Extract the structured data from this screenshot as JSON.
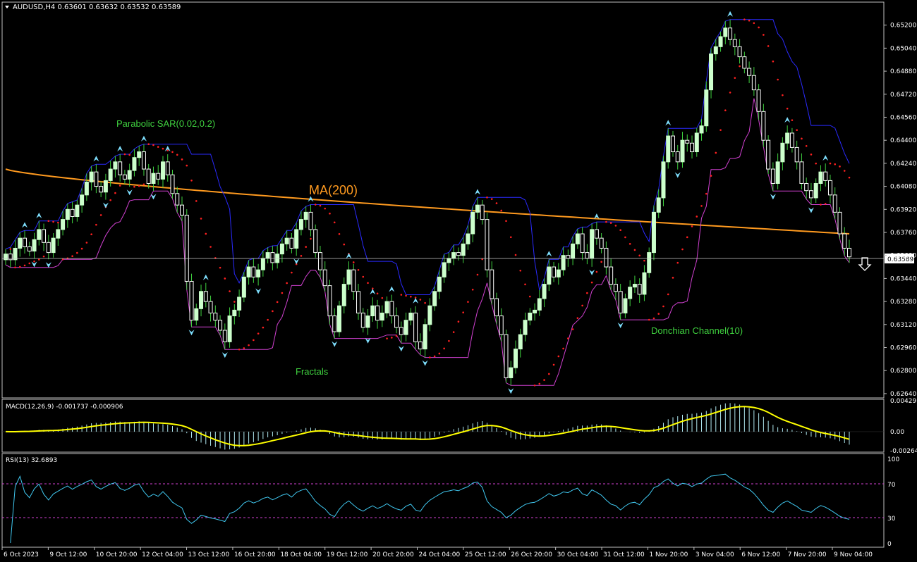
{
  "header": {
    "symbol_info": "AUDUSD,H4  0.63601 0.63632 0.63532 0.63589"
  },
  "annotations": {
    "sar": "Parabolic SAR(0.02,0.2)",
    "ma": "MA(200)",
    "donchian": "Donchian Channel(10)",
    "fractals": "Fractals"
  },
  "price_axis": {
    "ticks": [
      "0.65200",
      "0.65040",
      "0.64880",
      "0.64720",
      "0.64560",
      "0.64400",
      "0.64240",
      "0.64080",
      "0.63920",
      "0.63760",
      "0.63600",
      "0.63440",
      "0.63280",
      "0.63120",
      "0.62960",
      "0.62800",
      "0.62640"
    ],
    "current_price": "0.63589"
  },
  "time_axis": {
    "labels": [
      "6 Oct 2023",
      "9 Oct 12:00",
      "10 Oct 20:00",
      "12 Oct 04:00",
      "13 Oct 12:00",
      "16 Oct 20:00",
      "18 Oct 04:00",
      "19 Oct 12:00",
      "20 Oct 20:00",
      "24 Oct 04:00",
      "25 Oct 12:00",
      "26 Oct 20:00",
      "30 Oct 04:00",
      "31 Oct 12:00",
      "1 Nov 20:00",
      "3 Nov 04:00",
      "6 Nov 12:00",
      "7 Nov 20:00",
      "9 Nov 04:00"
    ]
  },
  "macd": {
    "label": "MACD(12,26,9) -0.001737 -0.000906",
    "ticks": [
      "0.004291",
      "0.00",
      "-0.002641"
    ]
  },
  "rsi": {
    "label": "RSI(13) 32.6893",
    "ticks": [
      "100",
      "70",
      "30",
      "0"
    ]
  },
  "colors": {
    "up_candle": "#ccffcc",
    "down_candle": "#ffffff",
    "wick": "#3fd13f",
    "ma": "#ff9a1f",
    "donchian_upper": "#2a2aff",
    "donchian_lower": "#d040d0",
    "sar": "#ff2020",
    "fractal": "#7fe0ff",
    "macd_signal": "#ffff00",
    "macd_hist": "#b0e8f0",
    "rsi_line": "#40c8f0",
    "rsi_levels": "#d040d0"
  },
  "chart_data": {
    "type": "candlestick",
    "symbol": "AUDUSD",
    "timeframe": "H4",
    "ohlc_last": {
      "open": 0.63601,
      "high": 0.63632,
      "low": 0.63532,
      "close": 0.63589
    },
    "close_approx": [
      0.6361,
      0.6357,
      0.6365,
      0.6372,
      0.6366,
      0.6363,
      0.6371,
      0.6378,
      0.6369,
      0.6362,
      0.6372,
      0.6378,
      0.6385,
      0.6392,
      0.6387,
      0.6395,
      0.6402,
      0.6411,
      0.6418,
      0.6408,
      0.6404,
      0.6412,
      0.642,
      0.6425,
      0.6416,
      0.6413,
      0.6419,
      0.6428,
      0.6432,
      0.642,
      0.641,
      0.6417,
      0.6413,
      0.6425,
      0.6416,
      0.6403,
      0.6395,
      0.6388,
      0.6342,
      0.6315,
      0.6323,
      0.6335,
      0.6328,
      0.632,
      0.6315,
      0.6308,
      0.63,
      0.6318,
      0.6322,
      0.6331,
      0.6345,
      0.6352,
      0.6345,
      0.635,
      0.6358,
      0.6362,
      0.6355,
      0.6361,
      0.6368,
      0.6372,
      0.6365,
      0.6378,
      0.6385,
      0.639,
      0.6378,
      0.6362,
      0.635,
      0.6339,
      0.6318,
      0.6307,
      0.6325,
      0.634,
      0.635,
      0.6335,
      0.632,
      0.631,
      0.6318,
      0.6325,
      0.6315,
      0.632,
      0.6328,
      0.6318,
      0.631,
      0.6305,
      0.6315,
      0.632,
      0.63,
      0.6295,
      0.6312,
      0.6325,
      0.6335,
      0.6345,
      0.6355,
      0.6358,
      0.6362,
      0.636,
      0.6368,
      0.6375,
      0.639,
      0.6395,
      0.6385,
      0.635,
      0.633,
      0.6318,
      0.6305,
      0.6275,
      0.6282,
      0.6295,
      0.6305,
      0.6315,
      0.632,
      0.6322,
      0.633,
      0.634,
      0.6352,
      0.6345,
      0.635,
      0.636,
      0.6358,
      0.6368,
      0.6375,
      0.6362,
      0.6358,
      0.6378,
      0.6372,
      0.6365,
      0.6352,
      0.634,
      0.6335,
      0.632,
      0.633,
      0.6338,
      0.634,
      0.6333,
      0.6348,
      0.6362,
      0.639,
      0.64,
      0.6425,
      0.6443,
      0.6432,
      0.6425,
      0.644,
      0.6438,
      0.6432,
      0.6445,
      0.645,
      0.6475,
      0.65,
      0.6505,
      0.6512,
      0.6518,
      0.651,
      0.6505,
      0.6498,
      0.649,
      0.6485,
      0.6475,
      0.646,
      0.644,
      0.642,
      0.641,
      0.6425,
      0.6438,
      0.6445,
      0.6435,
      0.6425,
      0.641,
      0.6405,
      0.64,
      0.641,
      0.6418,
      0.6412,
      0.6402,
      0.639,
      0.6375,
      0.6365,
      0.6359
    ],
    "ma200_approx": {
      "start": 0.642,
      "end": 0.6375
    },
    "y_range": [
      0.6262,
      0.6535
    ],
    "macd": {
      "value": -0.001737,
      "signal": -0.000906,
      "range": [
        -0.002641,
        0.004291
      ]
    },
    "rsi": {
      "value": 32.6893,
      "levels": [
        30,
        70
      ],
      "range": [
        0,
        100
      ]
    }
  }
}
